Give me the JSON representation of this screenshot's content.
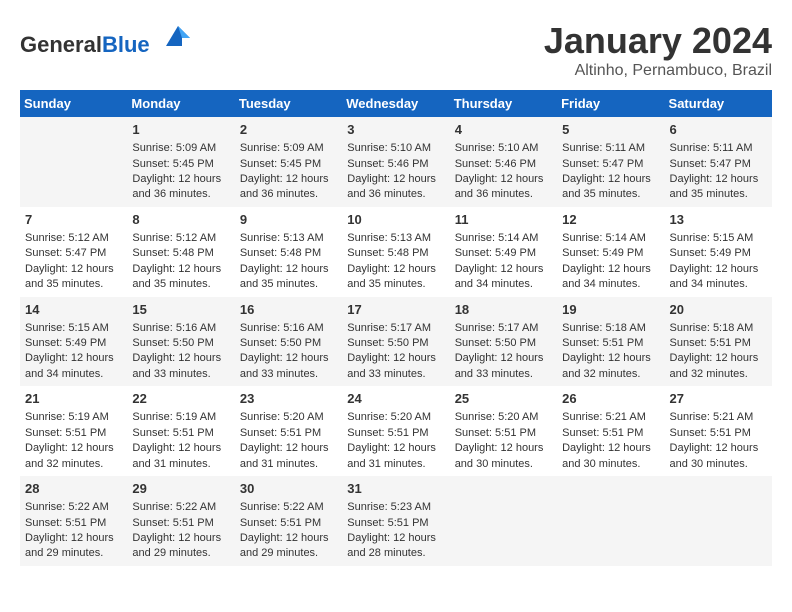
{
  "logo": {
    "general": "General",
    "blue": "Blue"
  },
  "title": "January 2024",
  "location": "Altinho, Pernambuco, Brazil",
  "headers": [
    "Sunday",
    "Monday",
    "Tuesday",
    "Wednesday",
    "Thursday",
    "Friday",
    "Saturday"
  ],
  "weeks": [
    [
      {
        "day": "",
        "lines": []
      },
      {
        "day": "1",
        "lines": [
          "Sunrise: 5:09 AM",
          "Sunset: 5:45 PM",
          "Daylight: 12 hours",
          "and 36 minutes."
        ]
      },
      {
        "day": "2",
        "lines": [
          "Sunrise: 5:09 AM",
          "Sunset: 5:45 PM",
          "Daylight: 12 hours",
          "and 36 minutes."
        ]
      },
      {
        "day": "3",
        "lines": [
          "Sunrise: 5:10 AM",
          "Sunset: 5:46 PM",
          "Daylight: 12 hours",
          "and 36 minutes."
        ]
      },
      {
        "day": "4",
        "lines": [
          "Sunrise: 5:10 AM",
          "Sunset: 5:46 PM",
          "Daylight: 12 hours",
          "and 36 minutes."
        ]
      },
      {
        "day": "5",
        "lines": [
          "Sunrise: 5:11 AM",
          "Sunset: 5:47 PM",
          "Daylight: 12 hours",
          "and 35 minutes."
        ]
      },
      {
        "day": "6",
        "lines": [
          "Sunrise: 5:11 AM",
          "Sunset: 5:47 PM",
          "Daylight: 12 hours",
          "and 35 minutes."
        ]
      }
    ],
    [
      {
        "day": "7",
        "lines": [
          "Sunrise: 5:12 AM",
          "Sunset: 5:47 PM",
          "Daylight: 12 hours",
          "and 35 minutes."
        ]
      },
      {
        "day": "8",
        "lines": [
          "Sunrise: 5:12 AM",
          "Sunset: 5:48 PM",
          "Daylight: 12 hours",
          "and 35 minutes."
        ]
      },
      {
        "day": "9",
        "lines": [
          "Sunrise: 5:13 AM",
          "Sunset: 5:48 PM",
          "Daylight: 12 hours",
          "and 35 minutes."
        ]
      },
      {
        "day": "10",
        "lines": [
          "Sunrise: 5:13 AM",
          "Sunset: 5:48 PM",
          "Daylight: 12 hours",
          "and 35 minutes."
        ]
      },
      {
        "day": "11",
        "lines": [
          "Sunrise: 5:14 AM",
          "Sunset: 5:49 PM",
          "Daylight: 12 hours",
          "and 34 minutes."
        ]
      },
      {
        "day": "12",
        "lines": [
          "Sunrise: 5:14 AM",
          "Sunset: 5:49 PM",
          "Daylight: 12 hours",
          "and 34 minutes."
        ]
      },
      {
        "day": "13",
        "lines": [
          "Sunrise: 5:15 AM",
          "Sunset: 5:49 PM",
          "Daylight: 12 hours",
          "and 34 minutes."
        ]
      }
    ],
    [
      {
        "day": "14",
        "lines": [
          "Sunrise: 5:15 AM",
          "Sunset: 5:49 PM",
          "Daylight: 12 hours",
          "and 34 minutes."
        ]
      },
      {
        "day": "15",
        "lines": [
          "Sunrise: 5:16 AM",
          "Sunset: 5:50 PM",
          "Daylight: 12 hours",
          "and 33 minutes."
        ]
      },
      {
        "day": "16",
        "lines": [
          "Sunrise: 5:16 AM",
          "Sunset: 5:50 PM",
          "Daylight: 12 hours",
          "and 33 minutes."
        ]
      },
      {
        "day": "17",
        "lines": [
          "Sunrise: 5:17 AM",
          "Sunset: 5:50 PM",
          "Daylight: 12 hours",
          "and 33 minutes."
        ]
      },
      {
        "day": "18",
        "lines": [
          "Sunrise: 5:17 AM",
          "Sunset: 5:50 PM",
          "Daylight: 12 hours",
          "and 33 minutes."
        ]
      },
      {
        "day": "19",
        "lines": [
          "Sunrise: 5:18 AM",
          "Sunset: 5:51 PM",
          "Daylight: 12 hours",
          "and 32 minutes."
        ]
      },
      {
        "day": "20",
        "lines": [
          "Sunrise: 5:18 AM",
          "Sunset: 5:51 PM",
          "Daylight: 12 hours",
          "and 32 minutes."
        ]
      }
    ],
    [
      {
        "day": "21",
        "lines": [
          "Sunrise: 5:19 AM",
          "Sunset: 5:51 PM",
          "Daylight: 12 hours",
          "and 32 minutes."
        ]
      },
      {
        "day": "22",
        "lines": [
          "Sunrise: 5:19 AM",
          "Sunset: 5:51 PM",
          "Daylight: 12 hours",
          "and 31 minutes."
        ]
      },
      {
        "day": "23",
        "lines": [
          "Sunrise: 5:20 AM",
          "Sunset: 5:51 PM",
          "Daylight: 12 hours",
          "and 31 minutes."
        ]
      },
      {
        "day": "24",
        "lines": [
          "Sunrise: 5:20 AM",
          "Sunset: 5:51 PM",
          "Daylight: 12 hours",
          "and 31 minutes."
        ]
      },
      {
        "day": "25",
        "lines": [
          "Sunrise: 5:20 AM",
          "Sunset: 5:51 PM",
          "Daylight: 12 hours",
          "and 30 minutes."
        ]
      },
      {
        "day": "26",
        "lines": [
          "Sunrise: 5:21 AM",
          "Sunset: 5:51 PM",
          "Daylight: 12 hours",
          "and 30 minutes."
        ]
      },
      {
        "day": "27",
        "lines": [
          "Sunrise: 5:21 AM",
          "Sunset: 5:51 PM",
          "Daylight: 12 hours",
          "and 30 minutes."
        ]
      }
    ],
    [
      {
        "day": "28",
        "lines": [
          "Sunrise: 5:22 AM",
          "Sunset: 5:51 PM",
          "Daylight: 12 hours",
          "and 29 minutes."
        ]
      },
      {
        "day": "29",
        "lines": [
          "Sunrise: 5:22 AM",
          "Sunset: 5:51 PM",
          "Daylight: 12 hours",
          "and 29 minutes."
        ]
      },
      {
        "day": "30",
        "lines": [
          "Sunrise: 5:22 AM",
          "Sunset: 5:51 PM",
          "Daylight: 12 hours",
          "and 29 minutes."
        ]
      },
      {
        "day": "31",
        "lines": [
          "Sunrise: 5:23 AM",
          "Sunset: 5:51 PM",
          "Daylight: 12 hours",
          "and 28 minutes."
        ]
      },
      {
        "day": "",
        "lines": []
      },
      {
        "day": "",
        "lines": []
      },
      {
        "day": "",
        "lines": []
      }
    ]
  ]
}
